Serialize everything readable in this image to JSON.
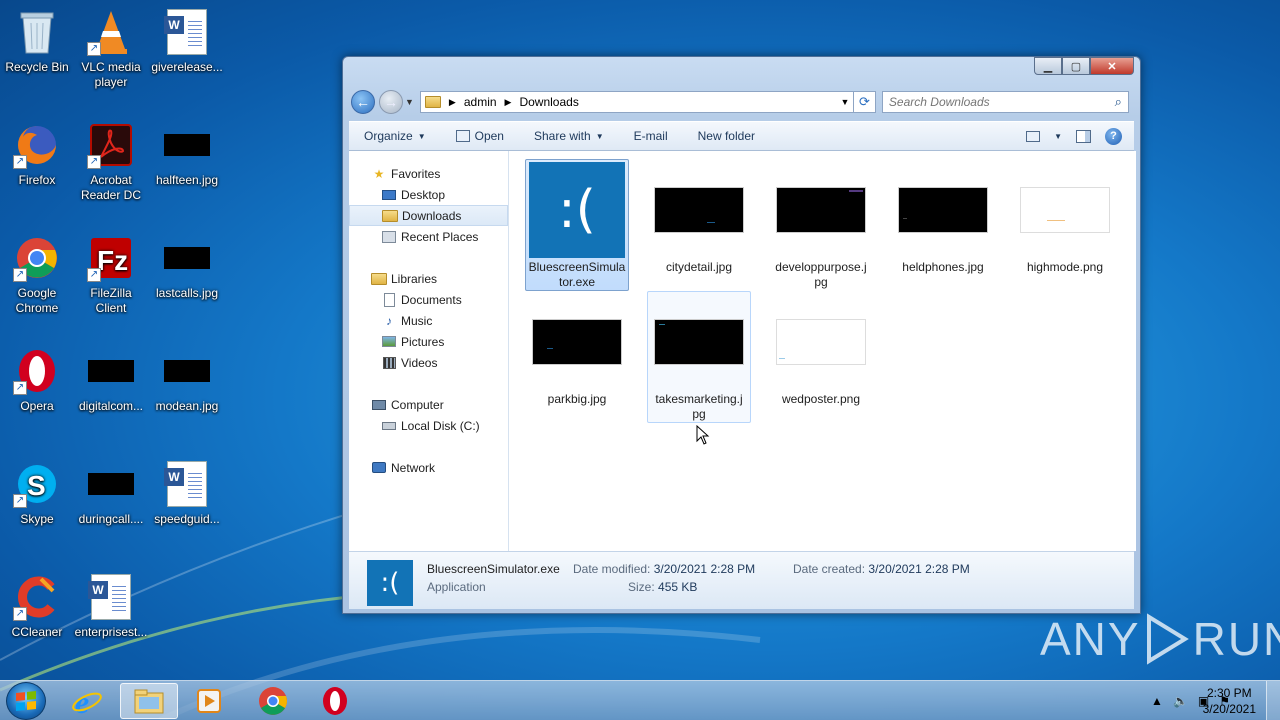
{
  "desktop": {
    "icons": [
      {
        "label": "Recycle Bin",
        "icon": "recycle-bin-icon"
      },
      {
        "label": "VLC media player",
        "icon": "vlc-icon"
      },
      {
        "label": "giverelease...",
        "icon": "word-doc-icon"
      },
      {
        "label": "Firefox",
        "icon": "firefox-icon"
      },
      {
        "label": "Acrobat Reader DC",
        "icon": "acrobat-icon"
      },
      {
        "label": "halfteen.jpg",
        "icon": "image-icon"
      },
      {
        "label": "Google Chrome",
        "icon": "chrome-icon"
      },
      {
        "label": "FileZilla Client",
        "icon": "filezilla-icon"
      },
      {
        "label": "lastcalls.jpg",
        "icon": "image-icon"
      },
      {
        "label": "Opera",
        "icon": "opera-icon"
      },
      {
        "label": "digitalcom...",
        "icon": "image-icon"
      },
      {
        "label": "modean.jpg",
        "icon": "image-icon"
      },
      {
        "label": "Skype",
        "icon": "skype-icon"
      },
      {
        "label": "duringcall....",
        "icon": "image-icon"
      },
      {
        "label": "speedguid...",
        "icon": "word-doc-icon"
      },
      {
        "label": "CCleaner",
        "icon": "ccleaner-icon"
      },
      {
        "label": "enterprisest...",
        "icon": "word-doc-icon"
      }
    ]
  },
  "explorer": {
    "address": {
      "crumbs": [
        "admin",
        "Downloads"
      ]
    },
    "search": {
      "placeholder": "Search Downloads"
    },
    "toolbar": {
      "organize": "Organize",
      "open": "Open",
      "share_with": "Share with",
      "email": "E-mail",
      "new_folder": "New folder"
    },
    "nav": {
      "favorites": "Favorites",
      "desktop": "Desktop",
      "downloads": "Downloads",
      "recent": "Recent Places",
      "libraries": "Libraries",
      "documents": "Documents",
      "music": "Music",
      "pictures": "Pictures",
      "videos": "Videos",
      "computer": "Computer",
      "local_disk": "Local Disk (C:)",
      "network": "Network"
    },
    "files": [
      {
        "name": "BluescreenSimulator.exe",
        "line1": "BluescreenSimula",
        "line2": "tor.exe"
      },
      {
        "name": "citydetail.jpg",
        "line1": "citydetail.jpg",
        "line2": ""
      },
      {
        "name": "developpurpose.jpg",
        "line1": "developpurpose.j",
        "line2": "pg"
      },
      {
        "name": "heldphones.jpg",
        "line1": "heldphones.jpg",
        "line2": ""
      },
      {
        "name": "highmode.png",
        "line1": "highmode.png",
        "line2": ""
      },
      {
        "name": "parkbig.jpg",
        "line1": "parkbig.jpg",
        "line2": ""
      },
      {
        "name": "takesmarketing.jpg",
        "line1": "takesmarketing.j",
        "line2": "pg"
      },
      {
        "name": "wedposter.png",
        "line1": "wedposter.png",
        "line2": ""
      }
    ],
    "details": {
      "name": "BluescreenSimulator.exe",
      "type": "Application",
      "modified_label": "Date modified:",
      "modified": "3/20/2021 2:28 PM",
      "size_label": "Size:",
      "size": "455 KB",
      "created_label": "Date created:",
      "created": "3/20/2021 2:28 PM"
    }
  },
  "taskbar": {
    "time": "2:30 PM",
    "date": "3/20/2021"
  },
  "watermark": {
    "left": "ANY",
    "right": "RUN"
  }
}
